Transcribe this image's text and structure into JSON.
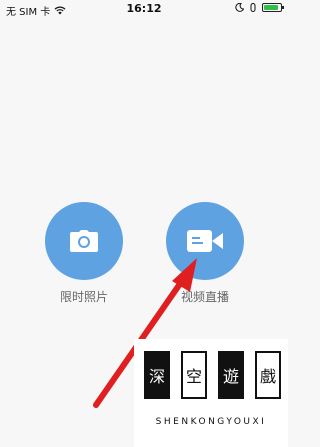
{
  "status_bar": {
    "carrier": "无 SIM 卡",
    "time": "16:12",
    "battery_level": 0.85
  },
  "actions": [
    {
      "label": "限时照片",
      "icon": "camera-icon"
    },
    {
      "label": "视频直播",
      "icon": "video-camera-icon"
    }
  ],
  "colors": {
    "button_blue": "#5ea2e2",
    "arrow_red": "#e02020",
    "battery_green": "#2ec04a"
  },
  "watermark": {
    "chars": [
      "深",
      "空",
      "遊",
      "戲"
    ],
    "subtitle": "SHENKONGYOUXI"
  }
}
